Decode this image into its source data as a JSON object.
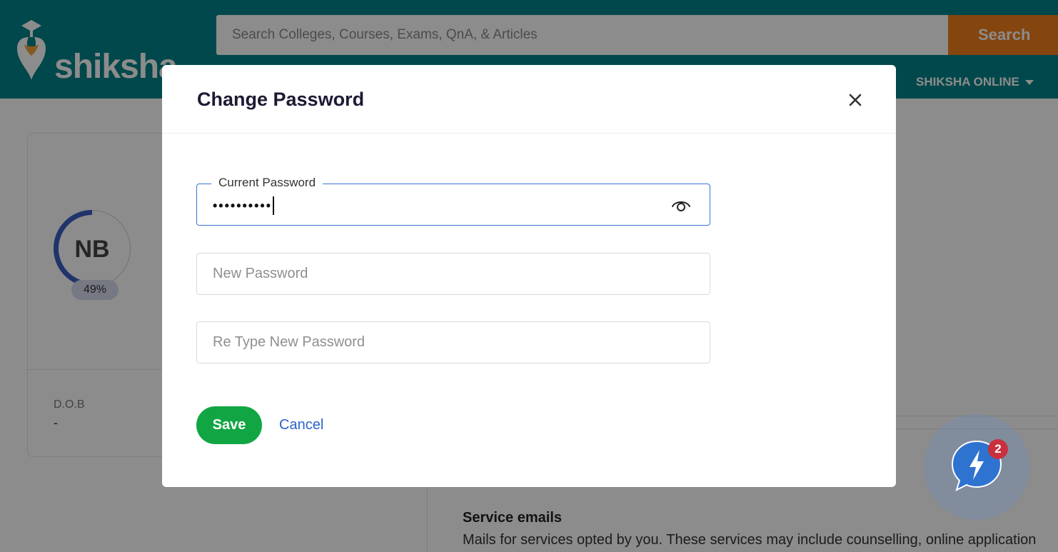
{
  "header": {
    "logo_text": "shiksha",
    "search_placeholder": "Search Colleges, Courses, Exams, QnA, & Articles",
    "search_button": "Search",
    "nav_items": [
      "SHIKSHA ONLINE"
    ]
  },
  "profile": {
    "initials": "NB",
    "completion": "49%",
    "completion_fraction": 0.49,
    "dob_label": "D.O.B",
    "dob_value": "-"
  },
  "emails": {
    "title": "Service emails",
    "description": "Mails for services opted by you. These services may include counselling, online application"
  },
  "chat": {
    "badge_count": "2"
  },
  "modal": {
    "title": "Change Password",
    "current_label": "Current Password",
    "current_masked": "••••••••••",
    "new_placeholder": "New Password",
    "retype_placeholder": "Re Type New Password",
    "save_label": "Save",
    "cancel_label": "Cancel"
  },
  "colors": {
    "header_bg": "#008489",
    "search_button": "#f07f1a",
    "save_button": "#11a643",
    "link": "#2b63c9",
    "focus_border": "#3a72d8"
  }
}
